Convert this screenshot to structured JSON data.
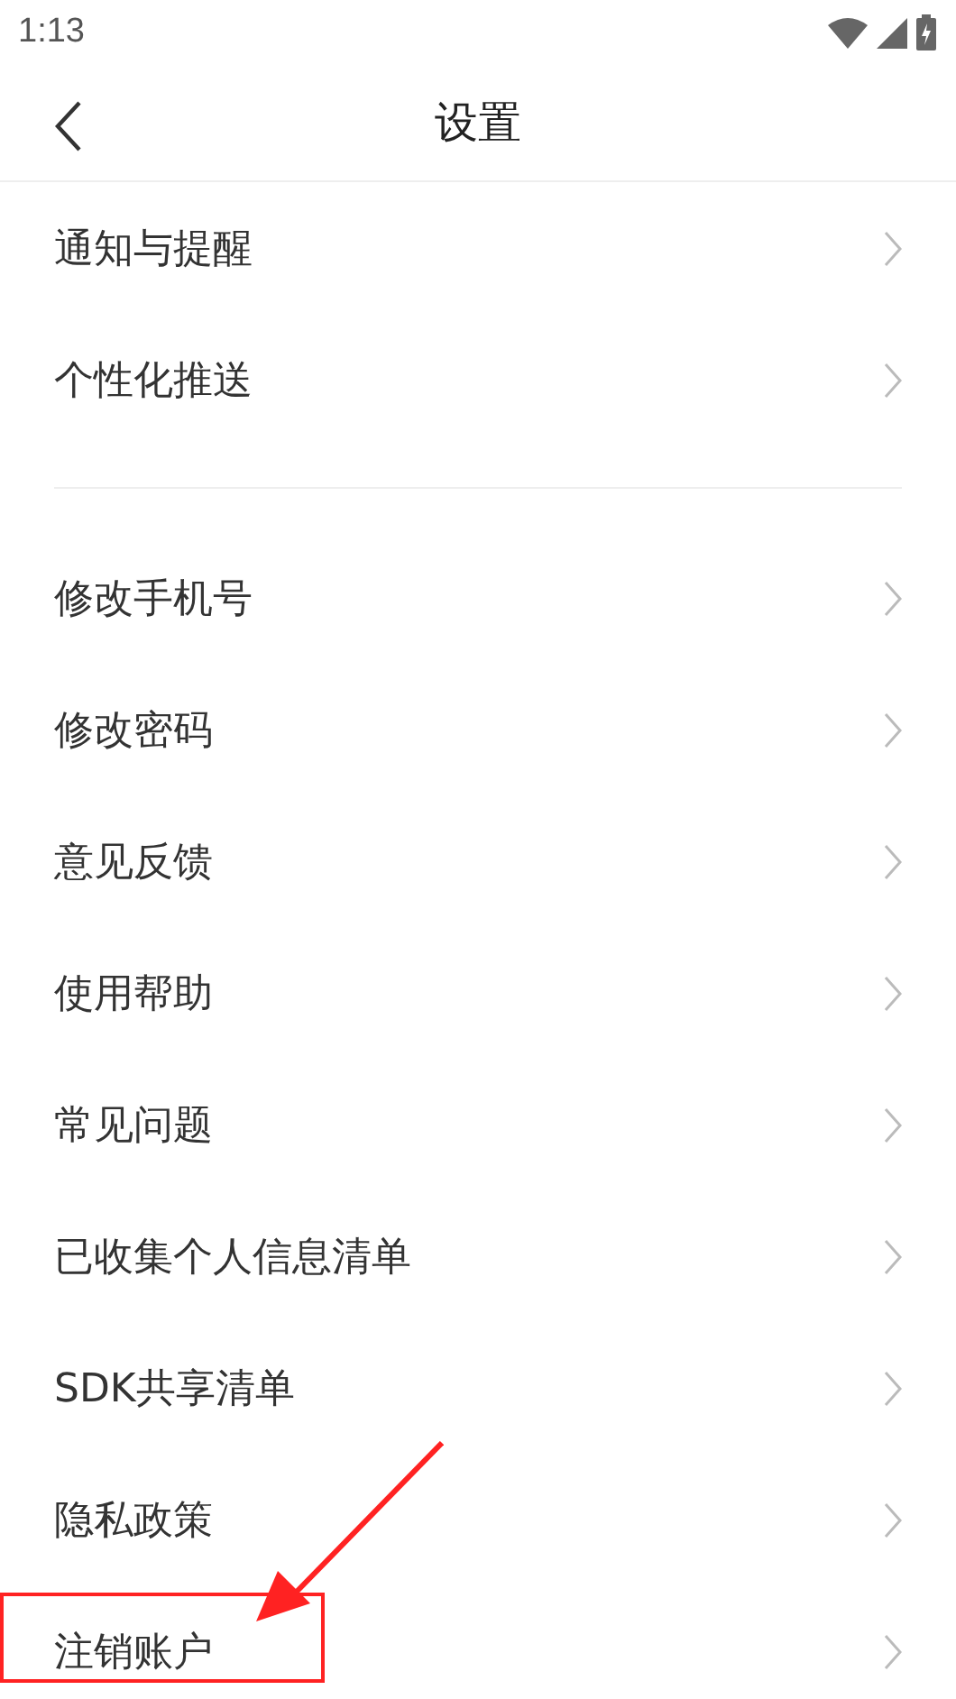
{
  "status_bar": {
    "time": "1:13"
  },
  "header": {
    "title": "设置"
  },
  "groups": [
    {
      "items": [
        {
          "label": "通知与提醒"
        },
        {
          "label": "个性化推送"
        }
      ]
    },
    {
      "items": [
        {
          "label": "修改手机号"
        },
        {
          "label": "修改密码"
        },
        {
          "label": "意见反馈"
        },
        {
          "label": "使用帮助"
        },
        {
          "label": "常见问题"
        },
        {
          "label": "已收集个人信息清单"
        },
        {
          "label": "SDK共享清单"
        },
        {
          "label": "隐私政策"
        },
        {
          "label": "注销账户"
        }
      ]
    }
  ]
}
